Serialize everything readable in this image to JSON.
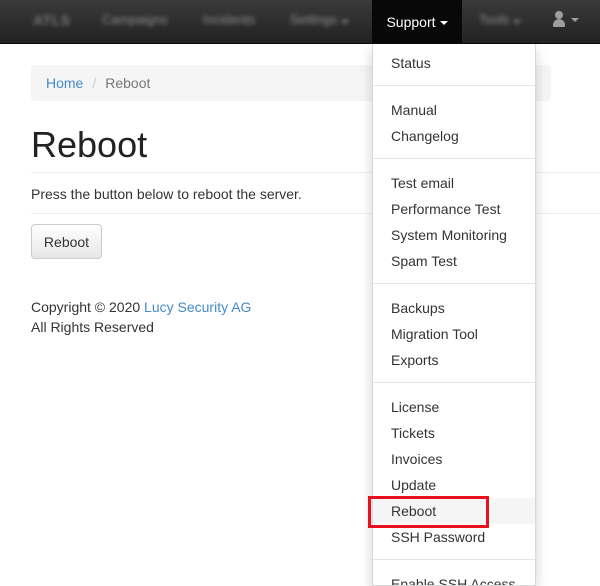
{
  "navbar": {
    "brand": "ATLS",
    "items": [
      "Campaigns",
      "Incidents",
      "Settings"
    ],
    "support_label": "Support",
    "tools_label": "Tools"
  },
  "breadcrumb": {
    "home": "Home",
    "separator": "/",
    "current": "Reboot"
  },
  "page": {
    "title": "Reboot",
    "description": "Press the button below to reboot the server.",
    "reboot_button": "Reboot"
  },
  "footer": {
    "copyright_prefix": "Copyright © 2020 ",
    "company": "Lucy Security AG",
    "rights": "All Rights Reserved"
  },
  "support_menu": {
    "groups": [
      [
        "Status"
      ],
      [
        "Manual",
        "Changelog"
      ],
      [
        "Test email",
        "Performance Test",
        "System Monitoring",
        "Spam Test"
      ],
      [
        "Backups",
        "Migration Tool",
        "Exports"
      ],
      [
        "License",
        "Tickets",
        "Invoices",
        "Update",
        "Reboot",
        "SSH Password"
      ],
      [
        "Enable SSH Access"
      ]
    ],
    "active_item": "Reboot",
    "highlight_color": "#e8101d"
  },
  "colors": {
    "link": "#428bca",
    "navbar": "#222222"
  }
}
